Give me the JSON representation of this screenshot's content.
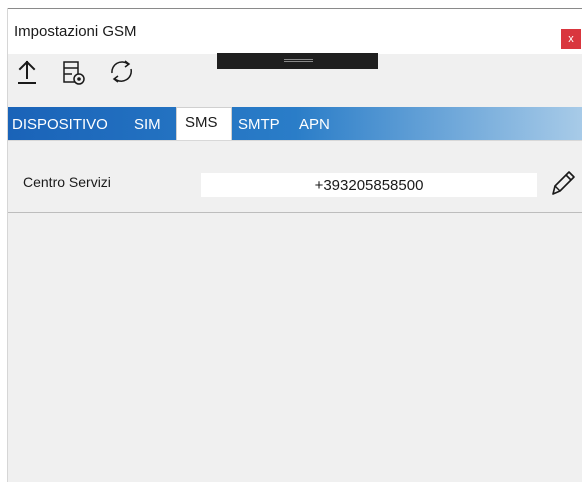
{
  "window": {
    "title": "Impostazioni GSM",
    "close_label": "x"
  },
  "toolbar": {
    "icons": [
      "upload-icon",
      "settings-file-icon",
      "refresh-icon"
    ]
  },
  "tabs": [
    {
      "label": "DISPOSITIVO",
      "active": false
    },
    {
      "label": "SIM",
      "active": false
    },
    {
      "label": "SMS",
      "active": true
    },
    {
      "label": "SMTP",
      "active": false
    },
    {
      "label": "APN",
      "active": false
    }
  ],
  "sms": {
    "service_center_label": "Centro Servizi",
    "service_center_value": "+393205858500"
  },
  "colors": {
    "tabbar_start": "#1a63b8",
    "tabbar_end": "#a8cbe8",
    "close_button": "#d9363e"
  }
}
